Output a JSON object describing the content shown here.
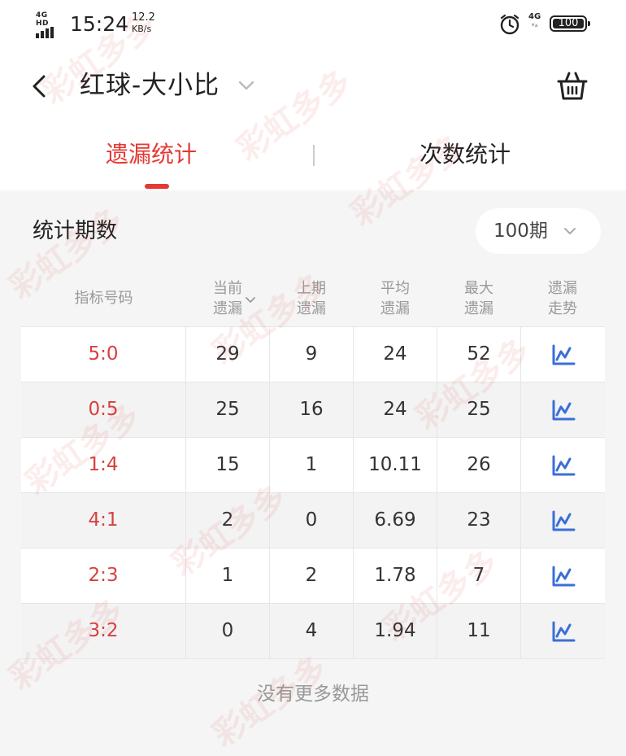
{
  "status_bar": {
    "network": "4G HD",
    "time": "15:24",
    "speed_value": "12.2",
    "speed_unit": "KB/s",
    "mobile_data": "4G",
    "battery": "100"
  },
  "header": {
    "title": "红球-大小比",
    "back_icon": "chevron-left-icon",
    "cart_icon": "basket-icon"
  },
  "tabs": [
    {
      "label": "遗漏统计",
      "active": true
    },
    {
      "label": "次数统计",
      "active": false
    }
  ],
  "period": {
    "label": "统计期数",
    "value": "100期"
  },
  "table": {
    "headers": [
      {
        "line1": "指标号码",
        "line2": ""
      },
      {
        "line1": "当前",
        "line2": "遗漏"
      },
      {
        "line1": "上期",
        "line2": "遗漏"
      },
      {
        "line1": "平均",
        "line2": "遗漏"
      },
      {
        "line1": "最大",
        "line2": "遗漏"
      },
      {
        "line1": "遗漏",
        "line2": "走势"
      }
    ],
    "rows": [
      {
        "indicator": "5:0",
        "current": "29",
        "previous": "9",
        "average": "24",
        "max": "52"
      },
      {
        "indicator": "0:5",
        "current": "25",
        "previous": "16",
        "average": "24",
        "max": "25"
      },
      {
        "indicator": "1:4",
        "current": "15",
        "previous": "1",
        "average": "10.11",
        "max": "26"
      },
      {
        "indicator": "4:1",
        "current": "2",
        "previous": "0",
        "average": "6.69",
        "max": "23"
      },
      {
        "indicator": "2:3",
        "current": "1",
        "previous": "2",
        "average": "1.78",
        "max": "7"
      },
      {
        "indicator": "3:2",
        "current": "0",
        "previous": "4",
        "average": "1.94",
        "max": "11"
      }
    ],
    "trend_icon": "line-chart-icon"
  },
  "footer": {
    "no_more": "没有更多数据"
  },
  "watermark": "彩虹多多",
  "colors": {
    "accent": "#e53935",
    "indicator_text": "#d84040",
    "trend_icon": "#3a6fd8"
  }
}
